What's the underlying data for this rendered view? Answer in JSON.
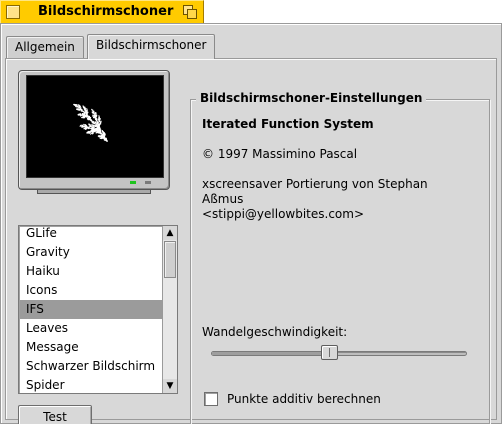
{
  "window": {
    "title": "Bildschirmschoner",
    "title_bar_color": "#ffcb00"
  },
  "tabs": [
    {
      "label": "Allgemein",
      "active": false
    },
    {
      "label": "Bildschirmschoner",
      "active": true
    }
  ],
  "preview": {
    "screen_color": "#000000",
    "fractal_color": "#ffffff"
  },
  "saver_list": {
    "items": [
      "GLife",
      "Gravity",
      "Haiku",
      "Icons",
      "IFS",
      "Leaves",
      "Message",
      "Schwarzer Bildschirm",
      "Spider"
    ],
    "selected": "IFS",
    "scroll_up_icon": "▲",
    "scroll_down_icon": "▼"
  },
  "test_button": {
    "label": "Test"
  },
  "settings": {
    "group_title": "Bildschirmschoner-Einstellungen",
    "module_name": "Iterated Function System",
    "copyright": "© 1997 Massimino Pascal",
    "port_lines": [
      "xscreensaver Portierung von Stephan",
      "Aßmus",
      "<stippi@yellowbites.com>"
    ],
    "speed_label": "Wandelgeschwindigkeit:",
    "speed_value": 0.46,
    "additive_label": "Punkte additiv berechnen",
    "additive_checked": false
  }
}
